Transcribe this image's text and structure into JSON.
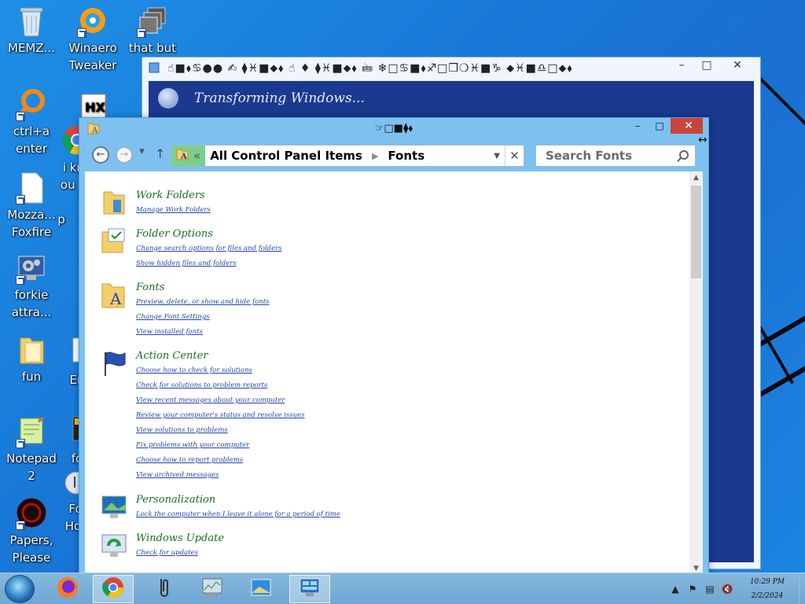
{
  "desktop": {
    "icons": [
      {
        "label": "MEMZ...",
        "icon": "recycle-bin-icon"
      },
      {
        "label": "Winaero\nTweaker",
        "icon": "winaero-icon"
      },
      {
        "label": "that but\nwh",
        "icon": "stacked-windows-icon"
      },
      {
        "label": "ctrl+a\nenter",
        "icon": "magnifier-ring-icon"
      },
      {
        "label": "",
        "icon": "hxd-icon"
      },
      {
        "label": "i kno\nou pe",
        "icon": "chrome-icon"
      },
      {
        "label": "Mozza...\nFoxfire",
        "icon": "file-icon"
      },
      {
        "label": "p",
        "icon": "file-icon"
      },
      {
        "label": "forkie\nattra...",
        "icon": "settings-monitor-icon"
      },
      {
        "label": "fun",
        "icon": "folder-icon"
      },
      {
        "label": "En",
        "icon": "file-icon"
      },
      {
        "label": "Notepad\n2",
        "icon": "notepad-icon"
      },
      {
        "label": "fo",
        "icon": "file-icon"
      },
      {
        "label": "Papers,\nPlease",
        "icon": "papers-please-icon"
      },
      {
        "label": "Fo\nHor",
        "icon": "music-icon"
      }
    ]
  },
  "background_window": {
    "title": "☝︎■︎⬧︎♋︎●︎●︎ ✍︎ ⧫︎♓︎■︎⬥︎⬧︎ ☝︎ ♦︎ ⧫︎♓︎■︎⬥︎⬧︎ 🖮︎ ❄︎□︎♋︎■︎⬧︎♐︎□︎❒︎❍︎♓︎■︎♑︎ ⬥︎♓︎■︎♎︎□︎⬥︎⬧︎",
    "header": "Transforming Windows..."
  },
  "main_window": {
    "title": "☞︎□︎■︎⧫︎⬧︎",
    "address": {
      "segments": [
        "All Control Panel Items",
        "Fonts"
      ],
      "prefix": "«"
    },
    "search_placeholder": "Search Fonts",
    "categories": [
      {
        "title": "Work Folders",
        "icon": "work-folders-icon",
        "links": [
          "Manage Work Folders"
        ]
      },
      {
        "title": "Folder Options",
        "icon": "folder-options-icon",
        "links": [
          "Change search options for files and folders",
          "Show hidden files and folders"
        ]
      },
      {
        "title": "Fonts",
        "icon": "fonts-folder-icon",
        "links": [
          "Preview, delete, or show and hide fonts",
          "Change Font Settings",
          "View installed fonts"
        ]
      },
      {
        "title": "Action Center",
        "icon": "action-center-flag-icon",
        "links": [
          "Choose how to check for solutions",
          "Check for solutions to problem reports",
          "View recent messages about your computer",
          "Review your computer's status and resolve issues",
          "View solutions to problems",
          "Fix problems with your computer",
          "Choose how to report problems",
          "View archived messages"
        ]
      },
      {
        "title": "Personalization",
        "icon": "personalization-icon",
        "links": [
          "Lock the computer when I leave it alone for a period of time"
        ]
      },
      {
        "title": "Windows Update",
        "icon": "windows-update-icon",
        "links": [
          "Check for updates"
        ]
      }
    ]
  },
  "taskbar": {
    "items": [
      "firefox-icon",
      "chrome-icon",
      "paperclip-icon",
      "task-manager-icon",
      "image-viewer-icon",
      "control-panel-icon"
    ],
    "clock": {
      "time": "10:29 PM",
      "date": "2/2/2024"
    }
  },
  "colors": {
    "accent": "#7ec1f0",
    "close": "#c7453c",
    "category_title": "#1d6c25",
    "link": "#2344a8",
    "address_highlight": "#7ccf8d"
  }
}
